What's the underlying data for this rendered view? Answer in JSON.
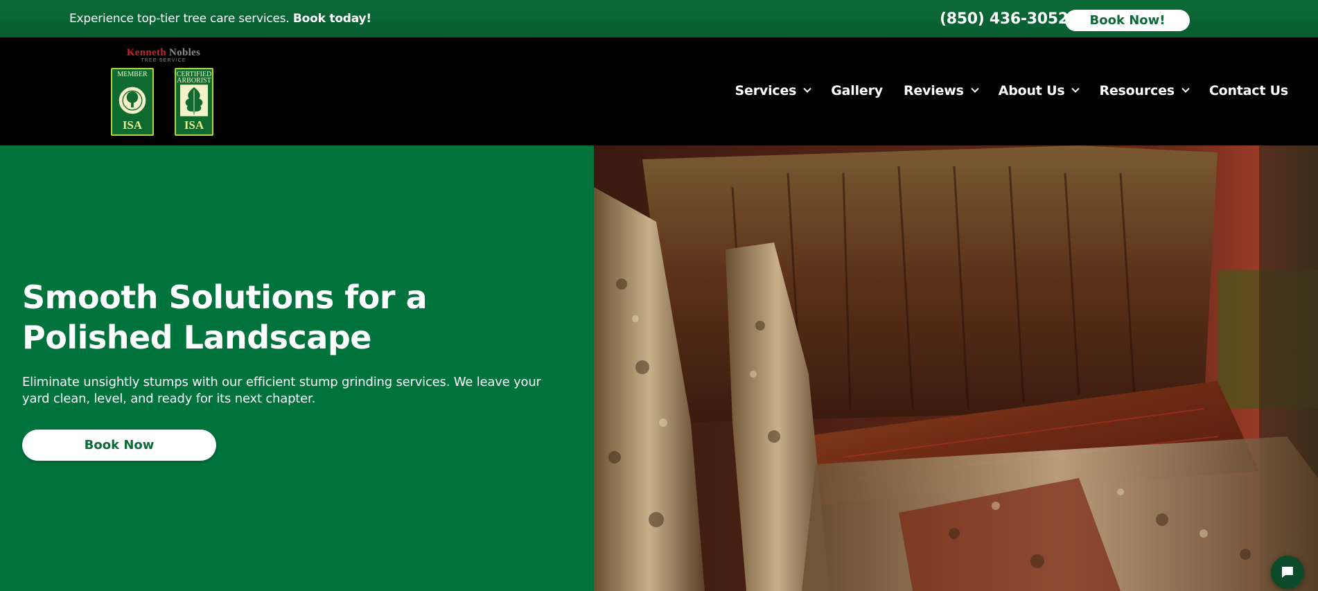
{
  "topbar": {
    "promo_text": "Experience top-tier tree care services.",
    "promo_bold": "Book today!",
    "phone": "(850) 436-3052",
    "book_button": "Book Now!"
  },
  "logo": {
    "brand_first": "Kenneth",
    "brand_last": "Nobles",
    "sub": "TREE SERVICE",
    "badge_member_caption": "MEMBER",
    "badge_certified_caption_1": "CERTIFIED",
    "badge_certified_caption_2": "ARBORIST",
    "badge_isa": "ISA"
  },
  "nav": {
    "items": [
      {
        "label": "Services",
        "dropdown": true
      },
      {
        "label": "Gallery",
        "dropdown": false
      },
      {
        "label": "Reviews",
        "dropdown": true
      },
      {
        "label": "About Us",
        "dropdown": true
      },
      {
        "label": "Resources",
        "dropdown": true
      },
      {
        "label": "Contact Us",
        "dropdown": false
      }
    ]
  },
  "hero": {
    "title": "Smooth Solutions for a Polished Landscape",
    "text": "Eliminate unsightly stumps with our efficient stump grinding services. We leave your yard clean, level, and ready for its next chapter.",
    "button": "Book Now"
  },
  "colors": {
    "brand_green": "#00733d",
    "topbar_green": "#0b6636",
    "header_bg": "#000000",
    "accent_red": "#c4232b"
  },
  "icons": {
    "chat": "chat-bubble-icon",
    "dropdown": "chevron-down-icon"
  }
}
